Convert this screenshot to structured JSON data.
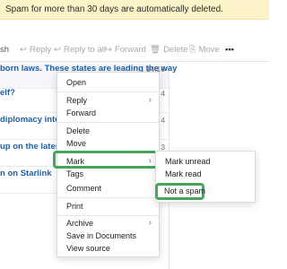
{
  "banner": {
    "text": "Spam for more than 30 days are automatically deleted."
  },
  "toolbar": {
    "fresh": "sh",
    "reply": "Reply",
    "reply_all": "Reply to all",
    "forward": "Forward",
    "delete": "Delete",
    "move": "Move",
    "more": "•••"
  },
  "emails": [
    {
      "subject": "born laws. These states are leading the way",
      "time": "14:16"
    },
    {
      "subject": "elf?",
      "time": "4"
    },
    {
      "subject": " diplomacy into the",
      "time": "4"
    },
    {
      "subject": " up on the latest SEC",
      "time": "3"
    },
    {
      "subject": "n on Starlink",
      "time": ""
    }
  ],
  "context_menu": {
    "open": "Open",
    "reply": "Reply",
    "forward": "Forward",
    "delete": "Delete",
    "move": "Move",
    "mark": "Mark",
    "tags": "Tags",
    "comment": "Comment",
    "print": "Print",
    "archive": "Archive",
    "save_in_documents": "Save in Documents",
    "view_source": "View source"
  },
  "mark_submenu": {
    "mark_unread": "Mark unread",
    "mark_read": "Mark read",
    "not_spam": "Not a spam"
  },
  "icons": {
    "reply": "reply-arrow-icon",
    "reply_all": "reply-all-icon",
    "forward": "forward-icon",
    "delete": "trash-icon",
    "move": "folder-move-icon",
    "chevron": "chevron-right-icon"
  },
  "colors": {
    "banner_bg": "#fcf3c9",
    "link": "#1e5fa8",
    "highlight": "#45a75b"
  }
}
